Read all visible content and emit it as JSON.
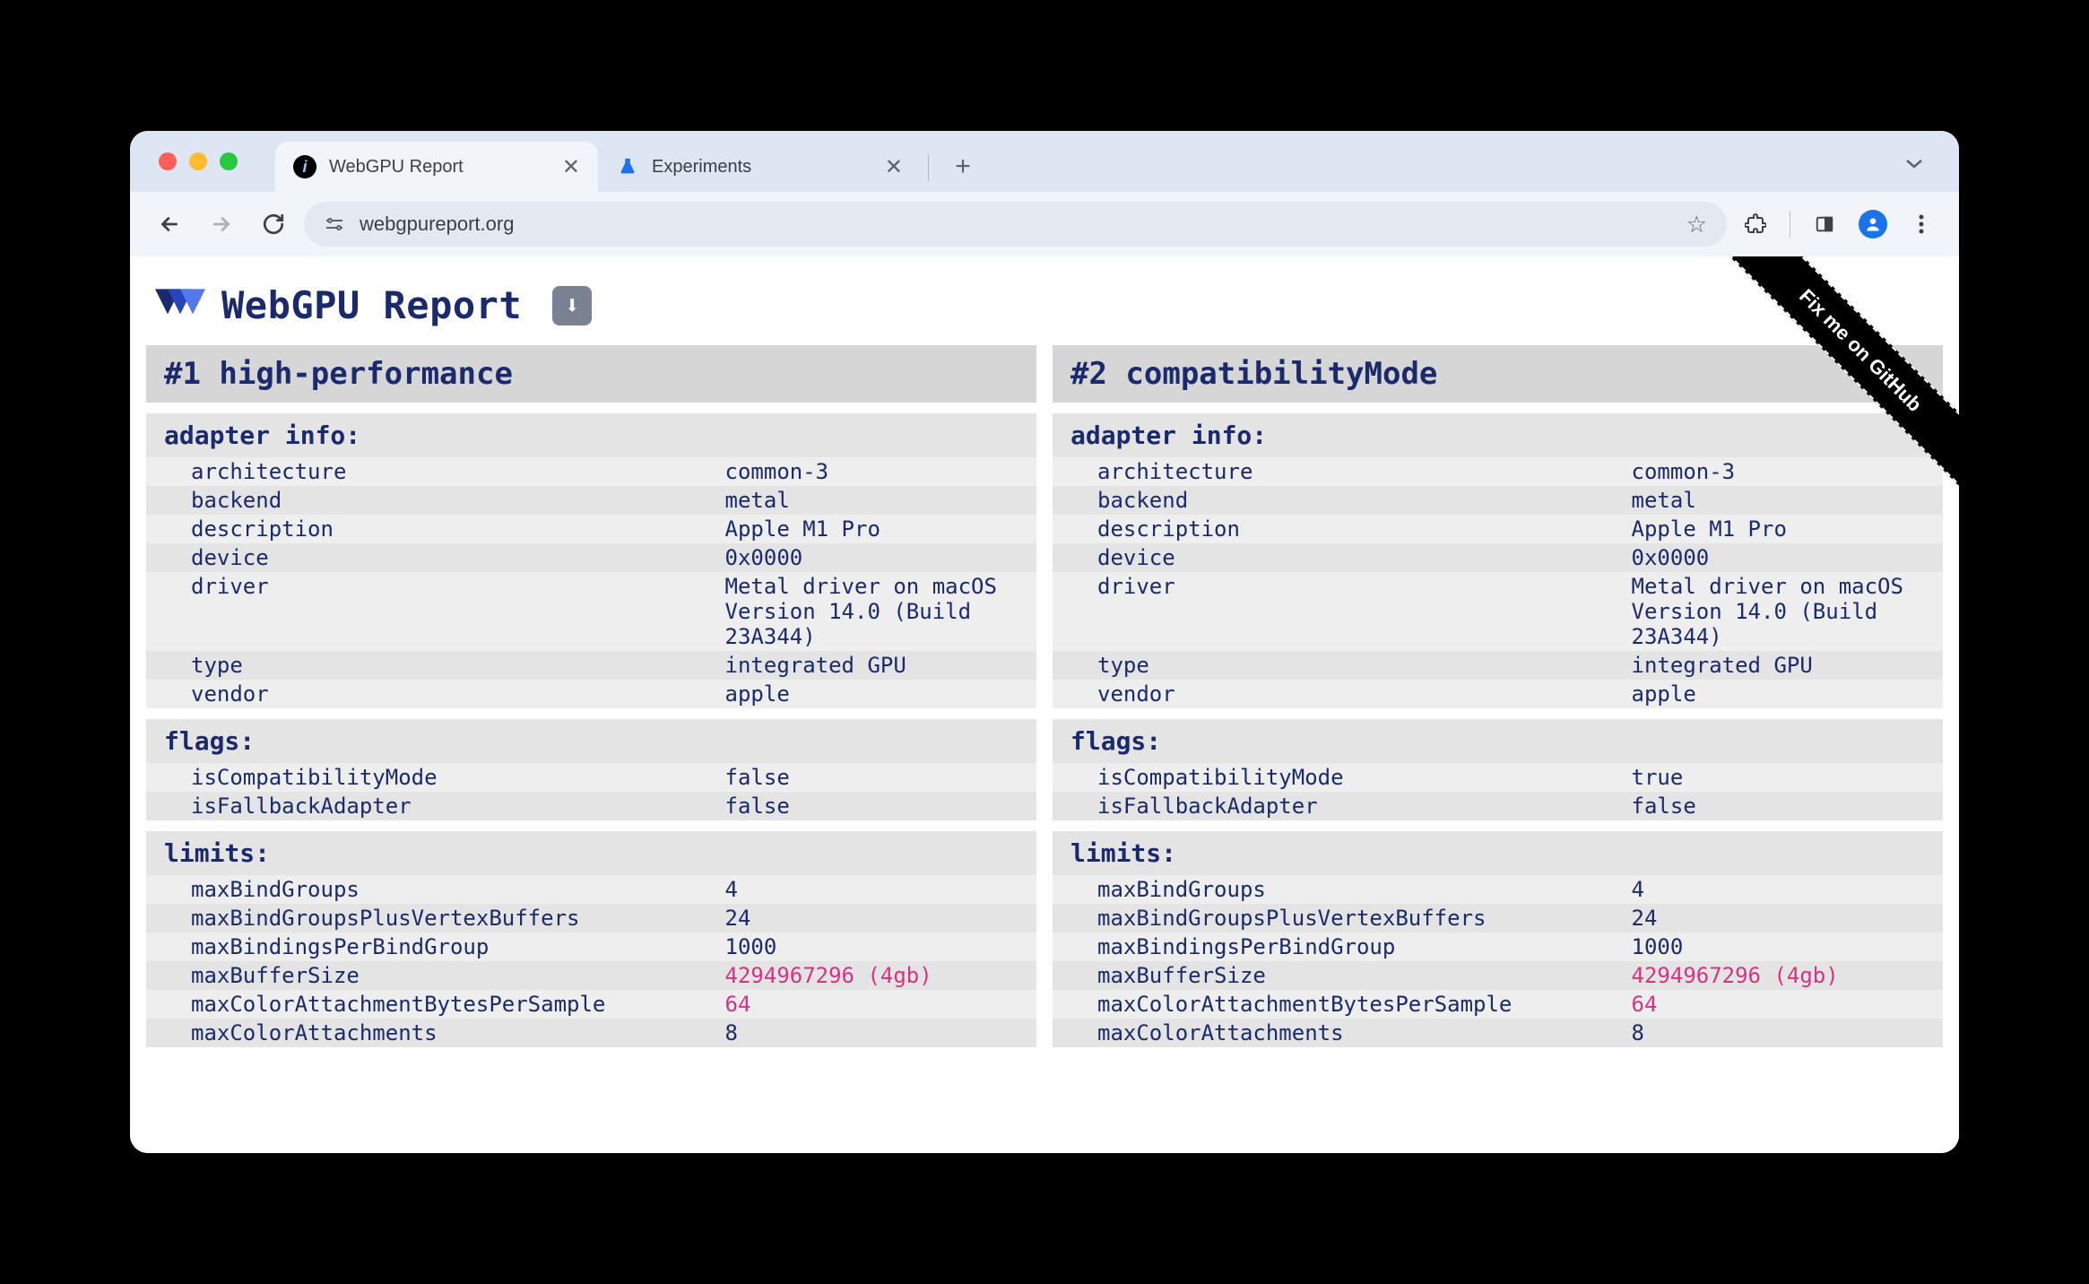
{
  "browser": {
    "tabs": [
      {
        "title": "WebGPU Report",
        "active": true,
        "favicon": "🛈"
      },
      {
        "title": "Experiments",
        "active": false,
        "favicon": "⚗"
      }
    ],
    "url": "webgpureport.org"
  },
  "page": {
    "title": "WebGPU Report",
    "github_ribbon": "Fix me on GitHub"
  },
  "adapters": [
    {
      "header": "#1 high-performance",
      "sections": [
        {
          "title": "adapter info:",
          "rows": [
            {
              "key": "architecture",
              "val": "common-3"
            },
            {
              "key": "backend",
              "val": "metal"
            },
            {
              "key": "description",
              "val": "Apple M1 Pro"
            },
            {
              "key": "device",
              "val": "0x0000"
            },
            {
              "key": "driver",
              "val": "Metal driver on macOS Version 14.0 (Build 23A344)"
            },
            {
              "key": "type",
              "val": "integrated GPU"
            },
            {
              "key": "vendor",
              "val": "apple"
            }
          ]
        },
        {
          "title": "flags:",
          "rows": [
            {
              "key": "isCompatibilityMode",
              "val": "false"
            },
            {
              "key": "isFallbackAdapter",
              "val": "false"
            }
          ]
        },
        {
          "title": "limits:",
          "rows": [
            {
              "key": "maxBindGroups",
              "val": "4"
            },
            {
              "key": "maxBindGroupsPlusVertexBuffers",
              "val": "24"
            },
            {
              "key": "maxBindingsPerBindGroup",
              "val": "1000"
            },
            {
              "key": "maxBufferSize",
              "val": "4294967296 (4gb)",
              "highlight": true
            },
            {
              "key": "maxColorAttachmentBytesPerSample",
              "val": "64",
              "highlight": true
            },
            {
              "key": "maxColorAttachments",
              "val": "8"
            }
          ]
        }
      ]
    },
    {
      "header": "#2 compatibilityMode",
      "sections": [
        {
          "title": "adapter info:",
          "rows": [
            {
              "key": "architecture",
              "val": "common-3"
            },
            {
              "key": "backend",
              "val": "metal"
            },
            {
              "key": "description",
              "val": "Apple M1 Pro"
            },
            {
              "key": "device",
              "val": "0x0000"
            },
            {
              "key": "driver",
              "val": "Metal driver on macOS Version 14.0 (Build 23A344)"
            },
            {
              "key": "type",
              "val": "integrated GPU"
            },
            {
              "key": "vendor",
              "val": "apple"
            }
          ]
        },
        {
          "title": "flags:",
          "rows": [
            {
              "key": "isCompatibilityMode",
              "val": "true"
            },
            {
              "key": "isFallbackAdapter",
              "val": "false"
            }
          ]
        },
        {
          "title": "limits:",
          "rows": [
            {
              "key": "maxBindGroups",
              "val": "4"
            },
            {
              "key": "maxBindGroupsPlusVertexBuffers",
              "val": "24"
            },
            {
              "key": "maxBindingsPerBindGroup",
              "val": "1000"
            },
            {
              "key": "maxBufferSize",
              "val": "4294967296 (4gb)",
              "highlight": true
            },
            {
              "key": "maxColorAttachmentBytesPerSample",
              "val": "64",
              "highlight": true
            },
            {
              "key": "maxColorAttachments",
              "val": "8"
            }
          ]
        }
      ]
    }
  ]
}
